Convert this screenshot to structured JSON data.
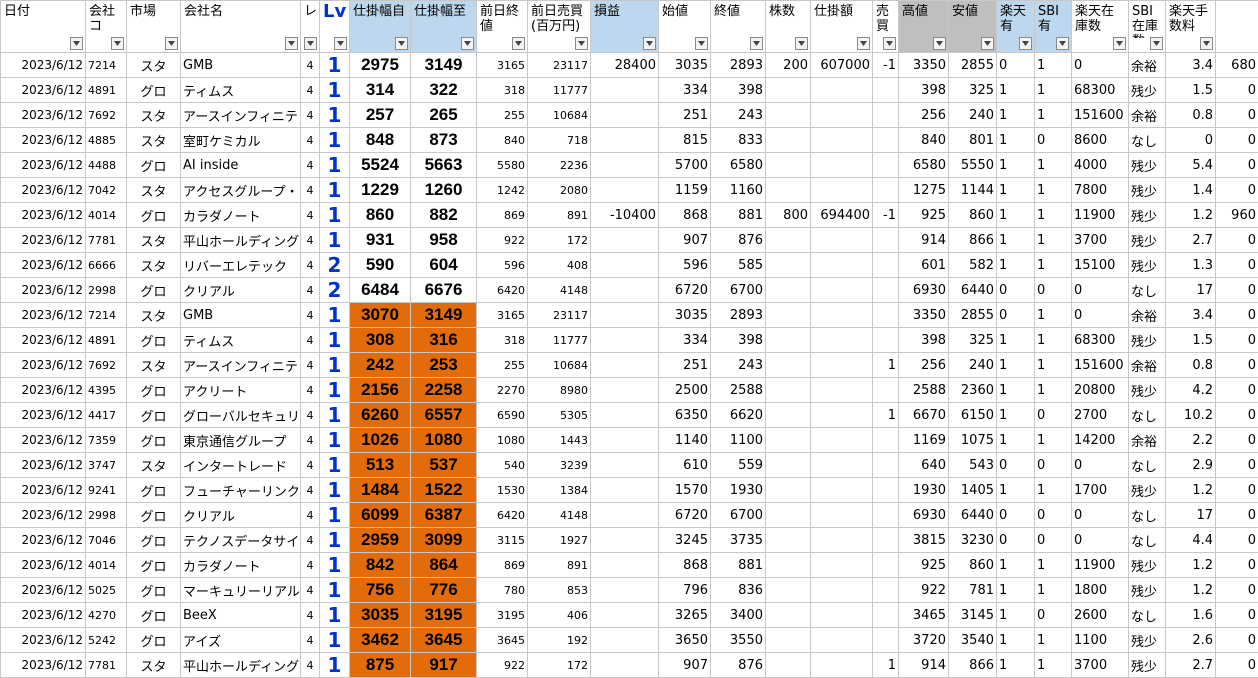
{
  "headers": [
    "日付",
    "会社コ",
    "市場",
    "会社名",
    "レ",
    "Lv",
    "仕掛幅自",
    "仕掛幅至",
    "前日終値",
    "前日売買(百万円)",
    "損益",
    "始値",
    "終値",
    "株数",
    "仕掛額",
    "売買",
    "高値",
    "安値",
    "楽天有",
    "SBI有",
    "楽天在庫数",
    "SBI在庫数",
    "楽天手数料",
    ""
  ],
  "colors": {
    "header_blue": "#bdd7ee",
    "header_gray": "#bfbfbf",
    "orange": "#e26b0a",
    "lv_blue": "#0033cc"
  },
  "rows": [
    {
      "date": "2023/6/12",
      "code": "7214",
      "market": "スタ",
      "name": "GMB",
      "re": "4",
      "lv": "1",
      "from": "2975",
      "to": "3149",
      "prev": "3165",
      "vol": "23117",
      "pnl": "28400",
      "open": "3035",
      "close": "2893",
      "shares": "200",
      "amount": "607000",
      "side": "-1",
      "high": "3350",
      "low": "2855",
      "r_has": "0",
      "s_has": "1",
      "r_stock": "0",
      "s_stock": "余裕",
      "r_fee": "3.4",
      "s_fee": "680",
      "hl": false
    },
    {
      "date": "2023/6/12",
      "code": "4891",
      "market": "グロ",
      "name": "ティムス",
      "re": "4",
      "lv": "1",
      "from": "314",
      "to": "322",
      "prev": "318",
      "vol": "11777",
      "pnl": "",
      "open": "334",
      "close": "398",
      "shares": "",
      "amount": "",
      "side": "",
      "high": "398",
      "low": "325",
      "r_has": "1",
      "s_has": "1",
      "r_stock": "68300",
      "s_stock": "残少",
      "r_fee": "1.5",
      "s_fee": "0",
      "hl": false
    },
    {
      "date": "2023/6/12",
      "code": "7692",
      "market": "スタ",
      "name": "アースインフィニテ",
      "re": "4",
      "lv": "1",
      "from": "257",
      "to": "265",
      "prev": "255",
      "vol": "10684",
      "pnl": "",
      "open": "251",
      "close": "243",
      "shares": "",
      "amount": "",
      "side": "",
      "high": "256",
      "low": "240",
      "r_has": "1",
      "s_has": "1",
      "r_stock": "151600",
      "s_stock": "余裕",
      "r_fee": "0.8",
      "s_fee": "0",
      "hl": false
    },
    {
      "date": "2023/6/12",
      "code": "4885",
      "market": "スタ",
      "name": "室町ケミカル",
      "re": "4",
      "lv": "1",
      "from": "848",
      "to": "873",
      "prev": "840",
      "vol": "718",
      "pnl": "",
      "open": "815",
      "close": "833",
      "shares": "",
      "amount": "",
      "side": "",
      "high": "840",
      "low": "801",
      "r_has": "1",
      "s_has": "0",
      "r_stock": "8600",
      "s_stock": "なし",
      "r_fee": "0",
      "s_fee": "0",
      "hl": false
    },
    {
      "date": "2023/6/12",
      "code": "4488",
      "market": "グロ",
      "name": "AI inside",
      "re": "4",
      "lv": "1",
      "from": "5524",
      "to": "5663",
      "prev": "5580",
      "vol": "2236",
      "pnl": "",
      "open": "5700",
      "close": "6580",
      "shares": "",
      "amount": "",
      "side": "",
      "high": "6580",
      "low": "5550",
      "r_has": "1",
      "s_has": "1",
      "r_stock": "4000",
      "s_stock": "残少",
      "r_fee": "5.4",
      "s_fee": "0",
      "hl": false
    },
    {
      "date": "2023/6/12",
      "code": "7042",
      "market": "スタ",
      "name": "アクセスグループ・",
      "re": "4",
      "lv": "1",
      "from": "1229",
      "to": "1260",
      "prev": "1242",
      "vol": "2080",
      "pnl": "",
      "open": "1159",
      "close": "1160",
      "shares": "",
      "amount": "",
      "side": "",
      "high": "1275",
      "low": "1144",
      "r_has": "1",
      "s_has": "1",
      "r_stock": "7800",
      "s_stock": "残少",
      "r_fee": "1.4",
      "s_fee": "0",
      "hl": false
    },
    {
      "date": "2023/6/12",
      "code": "4014",
      "market": "グロ",
      "name": "カラダノート",
      "re": "4",
      "lv": "1",
      "from": "860",
      "to": "882",
      "prev": "869",
      "vol": "891",
      "pnl": "-10400",
      "open": "868",
      "close": "881",
      "shares": "800",
      "amount": "694400",
      "side": "-1",
      "high": "925",
      "low": "860",
      "r_has": "1",
      "s_has": "1",
      "r_stock": "11900",
      "s_stock": "残少",
      "r_fee": "1.2",
      "s_fee": "960",
      "hl": false
    },
    {
      "date": "2023/6/12",
      "code": "7781",
      "market": "スタ",
      "name": "平山ホールディング",
      "re": "4",
      "lv": "1",
      "from": "931",
      "to": "958",
      "prev": "922",
      "vol": "172",
      "pnl": "",
      "open": "907",
      "close": "876",
      "shares": "",
      "amount": "",
      "side": "",
      "high": "914",
      "low": "866",
      "r_has": "1",
      "s_has": "1",
      "r_stock": "3700",
      "s_stock": "残少",
      "r_fee": "2.7",
      "s_fee": "0",
      "hl": false
    },
    {
      "date": "2023/6/12",
      "code": "6666",
      "market": "スタ",
      "name": "リバーエレテック",
      "re": "4",
      "lv": "2",
      "from": "590",
      "to": "604",
      "prev": "596",
      "vol": "408",
      "pnl": "",
      "open": "596",
      "close": "585",
      "shares": "",
      "amount": "",
      "side": "",
      "high": "601",
      "low": "582",
      "r_has": "1",
      "s_has": "1",
      "r_stock": "15100",
      "s_stock": "残少",
      "r_fee": "1.3",
      "s_fee": "0",
      "hl": false
    },
    {
      "date": "2023/6/12",
      "code": "2998",
      "market": "グロ",
      "name": "クリアル",
      "re": "4",
      "lv": "2",
      "from": "6484",
      "to": "6676",
      "prev": "6420",
      "vol": "4148",
      "pnl": "",
      "open": "6720",
      "close": "6700",
      "shares": "",
      "amount": "",
      "side": "",
      "high": "6930",
      "low": "6440",
      "r_has": "0",
      "s_has": "0",
      "r_stock": "0",
      "s_stock": "なし",
      "r_fee": "17",
      "s_fee": "0",
      "hl": false
    },
    {
      "date": "2023/6/12",
      "code": "7214",
      "market": "スタ",
      "name": "GMB",
      "re": "4",
      "lv": "1",
      "from": "3070",
      "to": "3149",
      "prev": "3165",
      "vol": "23117",
      "pnl": "",
      "open": "3035",
      "close": "2893",
      "shares": "",
      "amount": "",
      "side": "",
      "high": "3350",
      "low": "2855",
      "r_has": "0",
      "s_has": "1",
      "r_stock": "0",
      "s_stock": "余裕",
      "r_fee": "3.4",
      "s_fee": "0",
      "hl": true
    },
    {
      "date": "2023/6/12",
      "code": "4891",
      "market": "グロ",
      "name": "ティムス",
      "re": "4",
      "lv": "1",
      "from": "308",
      "to": "316",
      "prev": "318",
      "vol": "11777",
      "pnl": "",
      "open": "334",
      "close": "398",
      "shares": "",
      "amount": "",
      "side": "",
      "high": "398",
      "low": "325",
      "r_has": "1",
      "s_has": "1",
      "r_stock": "68300",
      "s_stock": "残少",
      "r_fee": "1.5",
      "s_fee": "0",
      "hl": true
    },
    {
      "date": "2023/6/12",
      "code": "7692",
      "market": "スタ",
      "name": "アースインフィニテ",
      "re": "4",
      "lv": "1",
      "from": "242",
      "to": "253",
      "prev": "255",
      "vol": "10684",
      "pnl": "",
      "open": "251",
      "close": "243",
      "shares": "",
      "amount": "",
      "side": "1",
      "high": "256",
      "low": "240",
      "r_has": "1",
      "s_has": "1",
      "r_stock": "151600",
      "s_stock": "余裕",
      "r_fee": "0.8",
      "s_fee": "0",
      "hl": true
    },
    {
      "date": "2023/6/12",
      "code": "4395",
      "market": "グロ",
      "name": "アクリート",
      "re": "4",
      "lv": "1",
      "from": "2156",
      "to": "2258",
      "prev": "2270",
      "vol": "8980",
      "pnl": "",
      "open": "2500",
      "close": "2588",
      "shares": "",
      "amount": "",
      "side": "",
      "high": "2588",
      "low": "2360",
      "r_has": "1",
      "s_has": "1",
      "r_stock": "20800",
      "s_stock": "残少",
      "r_fee": "4.2",
      "s_fee": "0",
      "hl": true
    },
    {
      "date": "2023/6/12",
      "code": "4417",
      "market": "グロ",
      "name": "グローバルセキュリ",
      "re": "4",
      "lv": "1",
      "from": "6260",
      "to": "6557",
      "prev": "6590",
      "vol": "5305",
      "pnl": "",
      "open": "6350",
      "close": "6620",
      "shares": "",
      "amount": "",
      "side": "1",
      "high": "6670",
      "low": "6150",
      "r_has": "1",
      "s_has": "0",
      "r_stock": "2700",
      "s_stock": "なし",
      "r_fee": "10.2",
      "s_fee": "0",
      "hl": true
    },
    {
      "date": "2023/6/12",
      "code": "7359",
      "market": "グロ",
      "name": "東京通信グループ",
      "re": "4",
      "lv": "1",
      "from": "1026",
      "to": "1080",
      "prev": "1080",
      "vol": "1443",
      "pnl": "",
      "open": "1140",
      "close": "1100",
      "shares": "",
      "amount": "",
      "side": "",
      "high": "1169",
      "low": "1075",
      "r_has": "1",
      "s_has": "1",
      "r_stock": "14200",
      "s_stock": "余裕",
      "r_fee": "2.2",
      "s_fee": "0",
      "hl": true
    },
    {
      "date": "2023/6/12",
      "code": "3747",
      "market": "スタ",
      "name": "インタートレード",
      "re": "4",
      "lv": "1",
      "from": "513",
      "to": "537",
      "prev": "540",
      "vol": "3239",
      "pnl": "",
      "open": "610",
      "close": "559",
      "shares": "",
      "amount": "",
      "side": "",
      "high": "640",
      "low": "543",
      "r_has": "0",
      "s_has": "0",
      "r_stock": "0",
      "s_stock": "なし",
      "r_fee": "2.9",
      "s_fee": "0",
      "hl": true
    },
    {
      "date": "2023/6/12",
      "code": "9241",
      "market": "グロ",
      "name": "フューチャーリンク",
      "re": "4",
      "lv": "1",
      "from": "1484",
      "to": "1522",
      "prev": "1530",
      "vol": "1384",
      "pnl": "",
      "open": "1570",
      "close": "1930",
      "shares": "",
      "amount": "",
      "side": "",
      "high": "1930",
      "low": "1405",
      "r_has": "1",
      "s_has": "1",
      "r_stock": "1700",
      "s_stock": "残少",
      "r_fee": "1.2",
      "s_fee": "0",
      "hl": true
    },
    {
      "date": "2023/6/12",
      "code": "2998",
      "market": "グロ",
      "name": "クリアル",
      "re": "4",
      "lv": "1",
      "from": "6099",
      "to": "6387",
      "prev": "6420",
      "vol": "4148",
      "pnl": "",
      "open": "6720",
      "close": "6700",
      "shares": "",
      "amount": "",
      "side": "",
      "high": "6930",
      "low": "6440",
      "r_has": "0",
      "s_has": "0",
      "r_stock": "0",
      "s_stock": "なし",
      "r_fee": "17",
      "s_fee": "0",
      "hl": true
    },
    {
      "date": "2023/6/12",
      "code": "7046",
      "market": "グロ",
      "name": "テクノスデータサイ",
      "re": "4",
      "lv": "1",
      "from": "2959",
      "to": "3099",
      "prev": "3115",
      "vol": "1927",
      "pnl": "",
      "open": "3245",
      "close": "3735",
      "shares": "",
      "amount": "",
      "side": "",
      "high": "3815",
      "low": "3230",
      "r_has": "0",
      "s_has": "0",
      "r_stock": "0",
      "s_stock": "なし",
      "r_fee": "4.4",
      "s_fee": "0",
      "hl": true
    },
    {
      "date": "2023/6/12",
      "code": "4014",
      "market": "グロ",
      "name": "カラダノート",
      "re": "4",
      "lv": "1",
      "from": "842",
      "to": "864",
      "prev": "869",
      "vol": "891",
      "pnl": "",
      "open": "868",
      "close": "881",
      "shares": "",
      "amount": "",
      "side": "",
      "high": "925",
      "low": "860",
      "r_has": "1",
      "s_has": "1",
      "r_stock": "11900",
      "s_stock": "残少",
      "r_fee": "1.2",
      "s_fee": "0",
      "hl": true
    },
    {
      "date": "2023/6/12",
      "code": "5025",
      "market": "グロ",
      "name": "マーキュリーリアル",
      "re": "4",
      "lv": "1",
      "from": "756",
      "to": "776",
      "prev": "780",
      "vol": "853",
      "pnl": "",
      "open": "796",
      "close": "836",
      "shares": "",
      "amount": "",
      "side": "",
      "high": "922",
      "low": "781",
      "r_has": "1",
      "s_has": "1",
      "r_stock": "1800",
      "s_stock": "残少",
      "r_fee": "1.2",
      "s_fee": "0",
      "hl": true
    },
    {
      "date": "2023/6/12",
      "code": "4270",
      "market": "グロ",
      "name": "BeeX",
      "re": "4",
      "lv": "1",
      "from": "3035",
      "to": "3195",
      "prev": "3195",
      "vol": "406",
      "pnl": "",
      "open": "3265",
      "close": "3400",
      "shares": "",
      "amount": "",
      "side": "",
      "high": "3465",
      "low": "3145",
      "r_has": "1",
      "s_has": "0",
      "r_stock": "2600",
      "s_stock": "なし",
      "r_fee": "1.6",
      "s_fee": "0",
      "hl": true
    },
    {
      "date": "2023/6/12",
      "code": "5242",
      "market": "グロ",
      "name": "アイズ",
      "re": "4",
      "lv": "1",
      "from": "3462",
      "to": "3645",
      "prev": "3645",
      "vol": "192",
      "pnl": "",
      "open": "3650",
      "close": "3550",
      "shares": "",
      "amount": "",
      "side": "",
      "high": "3720",
      "low": "3540",
      "r_has": "1",
      "s_has": "1",
      "r_stock": "1100",
      "s_stock": "残少",
      "r_fee": "2.6",
      "s_fee": "0",
      "hl": true
    },
    {
      "date": "2023/6/12",
      "code": "7781",
      "market": "スタ",
      "name": "平山ホールディング",
      "re": "4",
      "lv": "1",
      "from": "875",
      "to": "917",
      "prev": "922",
      "vol": "172",
      "pnl": "",
      "open": "907",
      "close": "876",
      "shares": "",
      "amount": "",
      "side": "1",
      "high": "914",
      "low": "866",
      "r_has": "1",
      "s_has": "1",
      "r_stock": "3700",
      "s_stock": "残少",
      "r_fee": "2.7",
      "s_fee": "0",
      "hl": true
    }
  ]
}
